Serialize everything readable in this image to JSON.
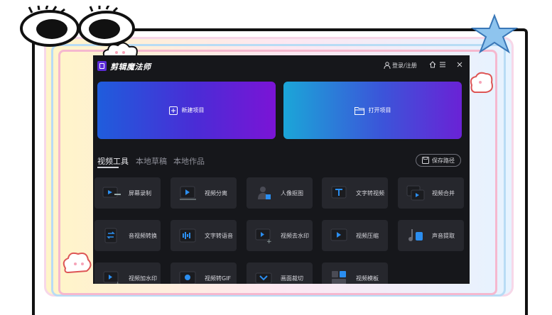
{
  "app": {
    "title": "剪辑魔法师",
    "login_label": "登录/注册"
  },
  "window_buttons": [
    "home-icon",
    "menu-icon",
    "close-icon"
  ],
  "cards": {
    "new_project": "新建项目",
    "open_project": "打开项目"
  },
  "tabs": [
    {
      "label": "视频工具",
      "active": true
    },
    {
      "label": "本地草稿",
      "active": false
    },
    {
      "label": "本地作品",
      "active": false
    }
  ],
  "save_path_label": "保存路径",
  "tools": [
    {
      "label": "屏幕录制",
      "icon": "screen-record-icon"
    },
    {
      "label": "视频分离",
      "icon": "video-split-icon"
    },
    {
      "label": "人像抠图",
      "icon": "portrait-cutout-icon"
    },
    {
      "label": "文字转视频",
      "icon": "text-to-video-icon"
    },
    {
      "label": "视频合并",
      "icon": "video-merge-icon"
    },
    {
      "label": "音视频转换",
      "icon": "av-convert-icon"
    },
    {
      "label": "文字转语音",
      "icon": "text-to-speech-icon"
    },
    {
      "label": "视频去水印",
      "icon": "remove-watermark-icon"
    },
    {
      "label": "视频压缩",
      "icon": "video-compress-icon"
    },
    {
      "label": "声音提取",
      "icon": "audio-extract-icon"
    },
    {
      "label": "视频加水印",
      "icon": "add-watermark-icon"
    },
    {
      "label": "视频转GIF",
      "icon": "video-to-gif-icon"
    },
    {
      "label": "画面裁切",
      "icon": "crop-icon"
    },
    {
      "label": "视频模板",
      "icon": "video-template-icon"
    }
  ],
  "colors": {
    "app_bg": "#16171b",
    "tool_bg": "#26272d",
    "accent_blue": "#2b8ef0"
  }
}
